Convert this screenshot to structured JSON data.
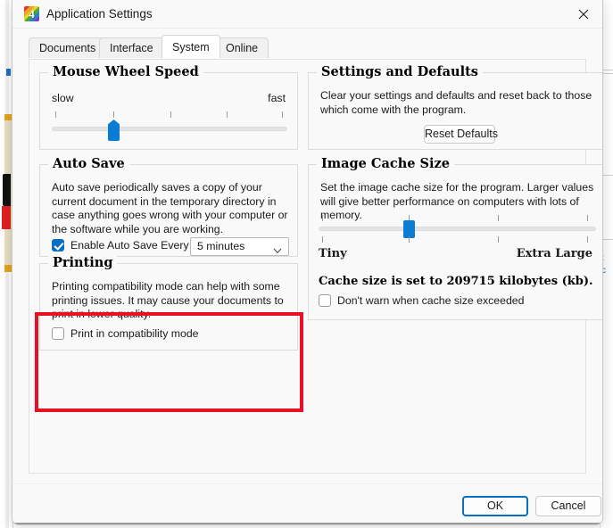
{
  "window": {
    "title": "Application Settings",
    "icon": "app-logo-icon",
    "icon_glyph": "4",
    "close_icon": "close-icon"
  },
  "tabs": [
    {
      "label": "Documents",
      "active": false
    },
    {
      "label": "Interface",
      "active": false
    },
    {
      "label": "System",
      "active": true
    },
    {
      "label": "Online",
      "active": false
    }
  ],
  "mouse_wheel": {
    "title": "Mouse Wheel Speed",
    "min_label": "slow",
    "max_label": "fast",
    "tick_count": 5,
    "value_index": 1
  },
  "auto_save": {
    "title": "Auto Save",
    "description": "Auto save periodically saves a copy of your current document in the temporary directory in case anything goes wrong with your computer or the software while you are working.",
    "checkbox_label": "Enable Auto Save Every",
    "checked": true,
    "interval_value": "5 minutes",
    "chevron_icon": "chevron-down-icon"
  },
  "printing": {
    "title": "Printing",
    "description": "Printing compatibility mode can help with some printing issues. It may cause your documents to print in lower quality.",
    "checkbox_label": "Print in compatibility mode",
    "checked": false,
    "highlight_color": "#e81123"
  },
  "settings_defaults": {
    "title": "Settings and Defaults",
    "description": "Clear your settings and defaults and reset back to those which come with the program.",
    "reset_button_label": "Reset Defaults"
  },
  "image_cache": {
    "title": "Image Cache Size",
    "description": "Set the image cache size for the program. Larger values will give better performance on computers with lots of memory.",
    "min_label": "Tiny",
    "max_label": "Extra Large",
    "tick_count": 4,
    "value_index": 1,
    "status_text": "Cache size is set to 209715 kilobytes (kb).",
    "checkbox_label": "Don't warn when cache size exceeded",
    "checked": false
  },
  "footer": {
    "ok_label": "OK",
    "cancel_label": "Cancel"
  },
  "colors": {
    "accent": "#0a7cd4",
    "checkbox_checked": "#0a6fc2",
    "highlight": "#e81123",
    "dialog_bg": "#f9f9f9"
  }
}
